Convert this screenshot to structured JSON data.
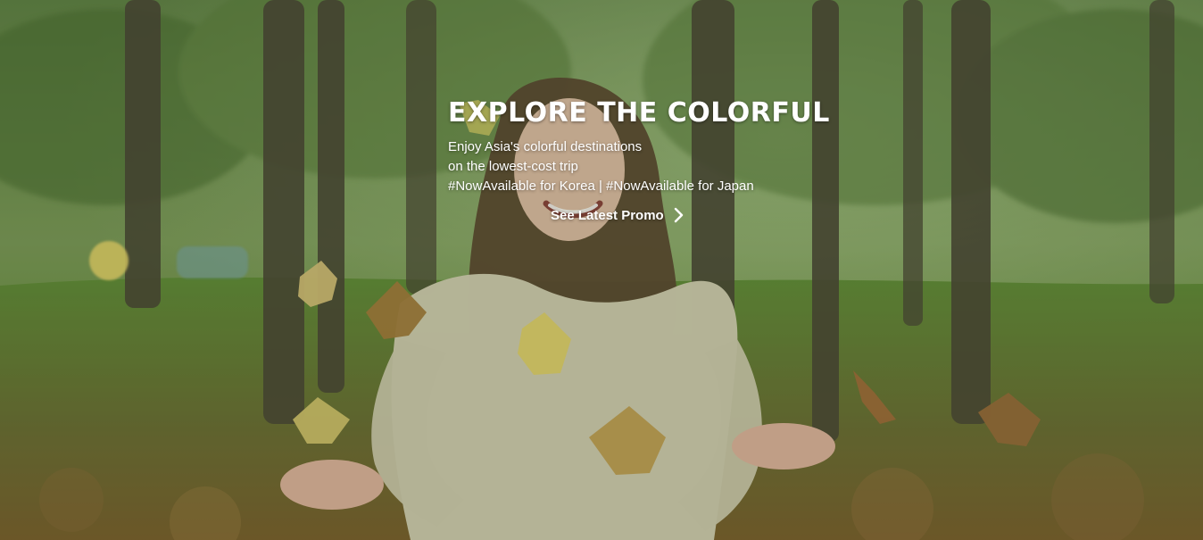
{
  "hero": {
    "title": "EXPLORE THE COLORFUL",
    "lines": [
      "Enjoy Asia's colorful destinations",
      "on the lowest-cost trip",
      "#NowAvailable for Korea | #NowAvailable for Japan"
    ],
    "cta_label": "See Latest Promo",
    "cta_icon": "chevron-right-icon",
    "background_description": "hero-photo"
  }
}
